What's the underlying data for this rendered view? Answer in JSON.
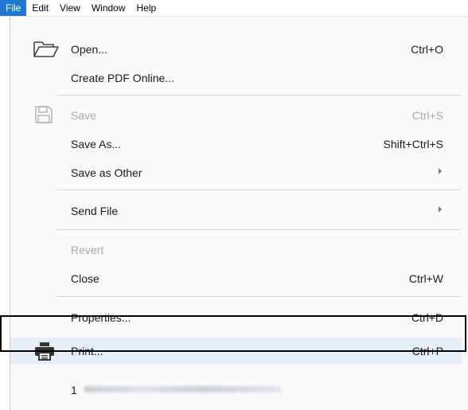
{
  "menubar": {
    "items": [
      {
        "label": "File",
        "active": true
      },
      {
        "label": "Edit"
      },
      {
        "label": "View"
      },
      {
        "label": "Window"
      },
      {
        "label": "Help"
      }
    ]
  },
  "menu": {
    "open": {
      "label": "Open...",
      "shortcut": "Ctrl+O",
      "icon": "folder-open-icon"
    },
    "create_pdf": {
      "label": "Create PDF Online..."
    },
    "save": {
      "label": "Save",
      "shortcut": "Ctrl+S",
      "icon": "save-icon",
      "disabled": true
    },
    "save_as": {
      "label": "Save As...",
      "shortcut": "Shift+Ctrl+S"
    },
    "save_other": {
      "label": "Save as Other",
      "submenu": true
    },
    "send_file": {
      "label": "Send File",
      "submenu": true
    },
    "revert": {
      "label": "Revert",
      "disabled": true
    },
    "close": {
      "label": "Close",
      "shortcut": "Ctrl+W"
    },
    "properties": {
      "label": "Properties...",
      "shortcut": "Ctrl+D"
    },
    "print": {
      "label": "Print...",
      "shortcut": "Ctrl+P",
      "icon": "printer-icon",
      "highlighted": true
    },
    "recent": {
      "number": "1"
    }
  },
  "colors": {
    "accent": "#1e78d2",
    "highlight": "#e6eef7",
    "disabled": "#a8a8a8"
  }
}
